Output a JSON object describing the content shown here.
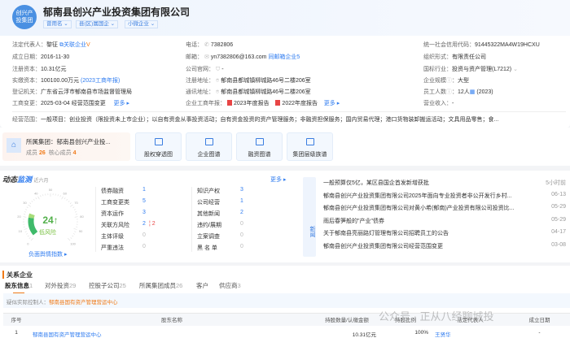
{
  "company": {
    "logo_text": [
      "创兴产",
      "投集团"
    ],
    "name": "郁南县创兴产业投资集团有限公司",
    "tags": [
      "曾用名",
      "县(区)属国企",
      "小微企业"
    ]
  },
  "info": {
    "legal_rep": {
      "label": "法定代表人：",
      "value": "黎征",
      "link": "关联企业"
    },
    "founded": {
      "label": "成立日期：",
      "value": "2016-11-30"
    },
    "reg_capital": {
      "label": "注册资本：",
      "value": "10.31亿元"
    },
    "paid_capital": {
      "label": "实缴资本：",
      "value": "100100.00万元",
      "link": "(2023工商年报)"
    },
    "authority": {
      "label": "登记机关：",
      "value": "广东省云浮市郁南县市场监督管理局"
    },
    "change": {
      "label": "工商变更：",
      "value": "2025-03-04 经营范围变更",
      "more": "更多"
    },
    "phone": {
      "label": "电话：",
      "value": "7382806"
    },
    "email": {
      "label": "邮箱：",
      "value": "yn7382806@163.com",
      "link": "同邮箱企业5"
    },
    "website": {
      "label": "公司官网：",
      "value": "-"
    },
    "reg_addr": {
      "label": "注册地址：",
      "value": "郁南县都城镇柳城路46号二楼206室"
    },
    "mail_addr": {
      "label": "通讯地址：",
      "value": "郁南县都城镇柳城路46号二楼206室"
    },
    "reports": {
      "label": "企业工商年报：",
      "items": [
        "2023年度报告",
        "2022年度报告"
      ],
      "more": "更多"
    },
    "credit_code": {
      "label": "统一社会信用代码：",
      "value": "91445322MA4W19HCXU"
    },
    "org_form": {
      "label": "组织形式：",
      "value": "有限责任公司"
    },
    "industry": {
      "label": "国标行业：",
      "value": "投资与资产管理(L7212)"
    },
    "scale": {
      "label": "企业规模",
      "value": "大型"
    },
    "employees": {
      "label": "员工人数",
      "value": "12人",
      "year": "(2023)"
    },
    "revenue": {
      "label": "营业收入：",
      "value": "-"
    },
    "scope": {
      "label": "经营范围：",
      "value": "一般项目：创业投资（限投资未上市企业）；以自有资金从事投资活动；自有资金投资的资产管理服务；非融资担保服务；国内贸易代理；港口货物装卸搬运活动；文具用品零售；食..."
    }
  },
  "group": {
    "label": "所属集团：",
    "name": "郁南县创兴产业投...",
    "members_label": "成员",
    "members": "26",
    "core_label": "核心成员",
    "core": "4",
    "buttons": [
      "股权穿透图",
      "企业图谱",
      "融资图谱",
      "集团层级族谱"
    ]
  },
  "monitor": {
    "title_a": "动态",
    "title_b": "监测",
    "period": "近六月",
    "more": "更多",
    "gauge": {
      "value": "24",
      "arrow": "↑",
      "level": "低风险",
      "link": "负面舆情指数",
      "ticks": [
        "0",
        "10",
        "20",
        "30",
        "40",
        "50",
        "60",
        "70",
        "80",
        "90",
        "100"
      ],
      "fraction": 0.24
    },
    "col1": [
      {
        "k": "债券融资",
        "v": "1"
      },
      {
        "k": "工商变更类",
        "v": "5"
      },
      {
        "k": "资本运作",
        "v": "3"
      },
      {
        "k": "关联方风险",
        "v": "2",
        "v2": "2"
      },
      {
        "k": "主体评级",
        "v": "0"
      },
      {
        "k": "严重违法",
        "v": "0"
      }
    ],
    "col2": [
      {
        "k": "知识产权",
        "v": "3"
      },
      {
        "k": "公司经营",
        "v": "1"
      },
      {
        "k": "其他新闻",
        "v": "2"
      },
      {
        "k": "违约/展期",
        "v": "0"
      },
      {
        "k": "立案调查",
        "v": "0"
      },
      {
        "k": "黑 名 单",
        "v": "0"
      }
    ]
  },
  "news": {
    "label": "新闻",
    "items": [
      {
        "t": "一般预算仅5亿，某区县国企首发新增获批",
        "d": "5小时前"
      },
      {
        "t": "郁南县创兴产业投资集团有限公司2025年面向专业投资者非公开发行乡村...",
        "d": "06-13"
      },
      {
        "t": "郁南县创兴产业投资集团有限公司对黄小希(郁南)产业投资有限公司投资比...",
        "d": "05-29"
      },
      {
        "t": "雨后春笋般的\"产业\"债券",
        "d": "05-29"
      },
      {
        "t": "关于郁南县亮丽路灯管理有限公司招聘员工的公告",
        "d": "04-17"
      },
      {
        "t": "郁南县创兴产业投资集团有限公司经营范围变更",
        "d": "03-08"
      }
    ]
  },
  "relations": {
    "title": "关系企业",
    "tabs": [
      {
        "l": "股东信息",
        "n": "1"
      },
      {
        "l": "对外投资",
        "n": "29"
      },
      {
        "l": "控股子公司",
        "n": "25"
      },
      {
        "l": "所属集团成员",
        "n": "26"
      },
      {
        "l": "客户",
        "n": ""
      },
      {
        "l": "供应商",
        "n": "3"
      }
    ],
    "controller_label": "疑似实际控制人：",
    "controller": "郁南县国有资产管理营运中心",
    "headers": [
      "序号",
      "股东名称",
      "持股数量/认缴金额",
      "持股比例",
      "法定代表人",
      "成立日期"
    ],
    "rows": [
      {
        "no": "1",
        "name": "郁南县国有资产管理营运中心",
        "amount": "10.31亿元",
        "ratio": "100%",
        "rep": "王贤华",
        "date": "-"
      }
    ]
  },
  "watermark": "公众号 · 正从八经聊城投"
}
